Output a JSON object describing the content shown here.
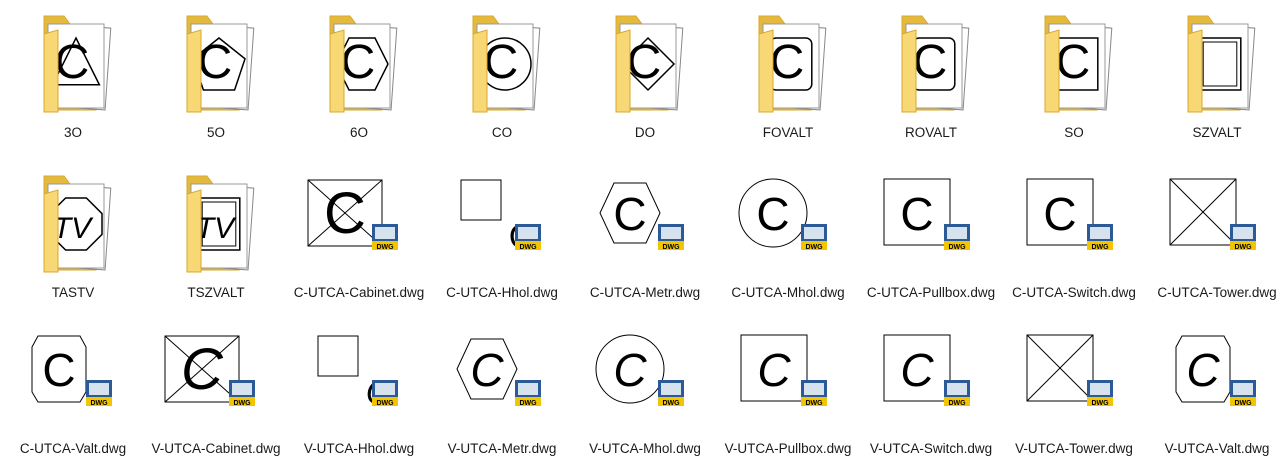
{
  "folders": [
    {
      "name": "3O",
      "sym": "C",
      "shape": "tri"
    },
    {
      "name": "5O",
      "sym": "C",
      "shape": "pent"
    },
    {
      "name": "6O",
      "sym": "C",
      "shape": "hex"
    },
    {
      "name": "CO",
      "sym": "C",
      "shape": "circ"
    },
    {
      "name": "DO",
      "sym": "C",
      "shape": "dia"
    },
    {
      "name": "FOVALT",
      "sym": "C",
      "shape": "valt"
    },
    {
      "name": "ROVALT",
      "sym": "C",
      "shape": "valt"
    },
    {
      "name": "SO",
      "sym": "C",
      "shape": "sq"
    },
    {
      "name": "SZVALT",
      "sym": "",
      "shape": "frame"
    },
    {
      "name": "TASTV",
      "sym": "TV",
      "shape": "oct"
    },
    {
      "name": "TSZVALT",
      "sym": "TV",
      "shape": "frame"
    }
  ],
  "files": [
    {
      "name": "C-UTCA-Cabinet.dwg",
      "shape": "cabinet",
      "sym": "C",
      "italic": false
    },
    {
      "name": "C-UTCA-Hhol.dwg",
      "shape": "hhol",
      "sym": "C",
      "italic": false
    },
    {
      "name": "C-UTCA-Metr.dwg",
      "shape": "hex",
      "sym": "C",
      "italic": false
    },
    {
      "name": "C-UTCA-Mhol.dwg",
      "shape": "circle",
      "sym": "C",
      "italic": false
    },
    {
      "name": "C-UTCA-Pullbox.dwg",
      "shape": "square",
      "sym": "C",
      "italic": false
    },
    {
      "name": "C-UTCA-Switch.dwg",
      "shape": "square",
      "sym": "C",
      "italic": false
    },
    {
      "name": "C-UTCA-Tower.dwg",
      "shape": "tower",
      "sym": "",
      "italic": false
    },
    {
      "name": "C-UTCA-Valt.dwg",
      "shape": "valt",
      "sym": "C",
      "italic": false
    },
    {
      "name": "V-UTCA-Cabinet.dwg",
      "shape": "cabinet",
      "sym": "C",
      "italic": true
    },
    {
      "name": "V-UTCA-Hhol.dwg",
      "shape": "hhol",
      "sym": "C",
      "italic": true
    },
    {
      "name": "V-UTCA-Metr.dwg",
      "shape": "hex",
      "sym": "C",
      "italic": true
    },
    {
      "name": "V-UTCA-Mhol.dwg",
      "shape": "circle",
      "sym": "C",
      "italic": true
    },
    {
      "name": "V-UTCA-Pullbox.dwg",
      "shape": "square",
      "sym": "C",
      "italic": true
    },
    {
      "name": "V-UTCA-Switch.dwg",
      "shape": "square",
      "sym": "C",
      "italic": true
    },
    {
      "name": "V-UTCA-Tower.dwg",
      "shape": "tower",
      "sym": "",
      "italic": true
    },
    {
      "name": "V-UTCA-Valt.dwg",
      "shape": "valt",
      "sym": "C",
      "italic": true
    }
  ],
  "badge_text": "DWG",
  "colors": {
    "folder_back": "#e3b93e",
    "folder_front": "#f8d775",
    "folder_edge": "#d9a82f",
    "dwg_blue": "#2b5a96",
    "dwg_yellow": "#f2c500"
  }
}
